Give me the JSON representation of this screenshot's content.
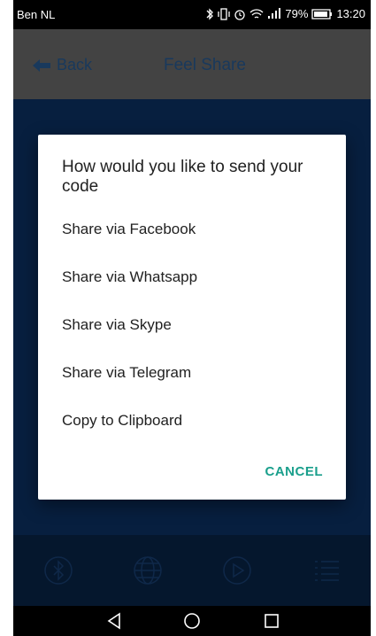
{
  "status_bar": {
    "carrier": "Ben NL",
    "battery": "79%",
    "time": "13:20"
  },
  "app_bar": {
    "back_label": "Back",
    "title": "Feel Share"
  },
  "dialog": {
    "title": "How would you like to send your code",
    "options": [
      "Share via Facebook",
      "Share via Whatsapp",
      "Share via Skype",
      "Share via Telegram",
      "Copy to Clipboard"
    ],
    "cancel_label": "CANCEL"
  },
  "bottom_nav": {
    "icons": [
      "bluetooth-icon",
      "globe-icon",
      "play-icon",
      "list-icon"
    ]
  },
  "colors": {
    "app_bar": "#7a7a7a",
    "content": "#0e3a73",
    "accent": "#1a9f8c",
    "title_text": "#2f68a8"
  }
}
